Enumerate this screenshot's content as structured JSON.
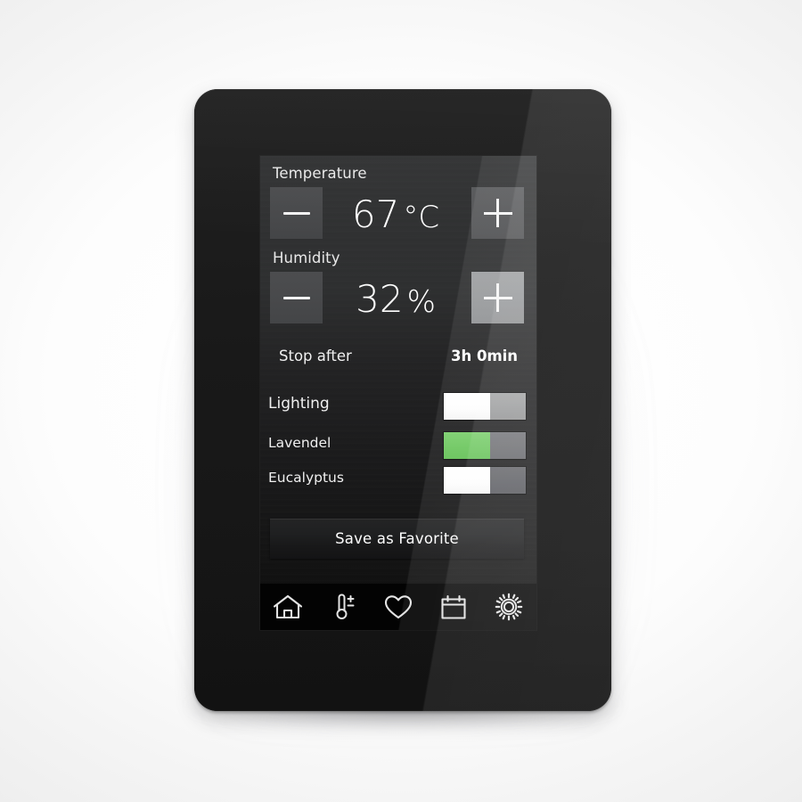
{
  "device": {
    "name": "wall-control-panel"
  },
  "screen": {
    "temperature": {
      "label": "Temperature",
      "value": "67",
      "unit": "°C",
      "decrease_label": "−",
      "increase_label": "+"
    },
    "humidity": {
      "label": "Humidity",
      "value": "32",
      "unit": "%",
      "decrease_label": "−",
      "increase_label": "+"
    },
    "stop_after": {
      "label": "Stop after",
      "value": "3h 0min"
    },
    "toggles": [
      {
        "label": "Lighting",
        "state": "on",
        "color": "#ffffff"
      },
      {
        "label": "Lavendel",
        "state": "on",
        "color": "#6cc75e"
      },
      {
        "label": "Eucalyptus",
        "state": "on",
        "color": "#ffffff"
      }
    ],
    "save_button": {
      "label": "Save as Favorite"
    },
    "nav": [
      {
        "name": "home-icon",
        "label": "Home"
      },
      {
        "name": "thermometer-icon",
        "label": "Climate"
      },
      {
        "name": "heart-icon",
        "label": "Favorites"
      },
      {
        "name": "calendar-icon",
        "label": "Schedule"
      },
      {
        "name": "gear-icon",
        "label": "Settings"
      }
    ]
  },
  "colors": {
    "accent_green": "#6cc75e",
    "toggle_on_white": "#ffffff",
    "screen_bg_top": "#313233",
    "screen_bg_bottom": "#0d0d0d",
    "navbar_bg": "#030303"
  }
}
